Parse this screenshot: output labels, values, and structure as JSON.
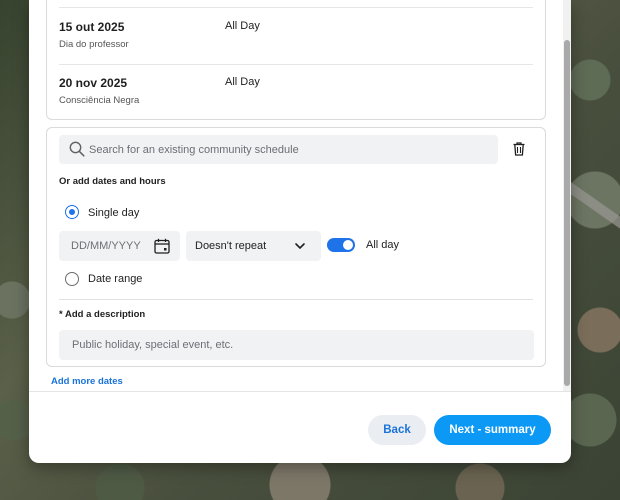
{
  "dates": [
    {
      "date": "15 out 2025",
      "name": "Dia do professor",
      "time": "All Day"
    },
    {
      "date": "20 nov 2025",
      "name": "Consciência Negra",
      "time": "All Day"
    }
  ],
  "search": {
    "placeholder": "Search for an existing community schedule"
  },
  "section_label": "Or add dates and hours",
  "options": {
    "single_day": "Single day",
    "date_range": "Date range",
    "selected": "single_day"
  },
  "date_field": {
    "placeholder": "DD/MM/YYYY"
  },
  "repeat_select": {
    "value": "Doesn't repeat"
  },
  "all_day": {
    "label": "All day",
    "on": true
  },
  "description": {
    "label": "* Add a description",
    "placeholder": "Public holiday, special event, etc."
  },
  "add_more_label": "Add more dates",
  "buttons": {
    "back": "Back",
    "next": "Next - summary"
  },
  "colors": {
    "accent": "#1e73e8",
    "primary_button": "#0c99f5",
    "link": "#1a73d9"
  }
}
